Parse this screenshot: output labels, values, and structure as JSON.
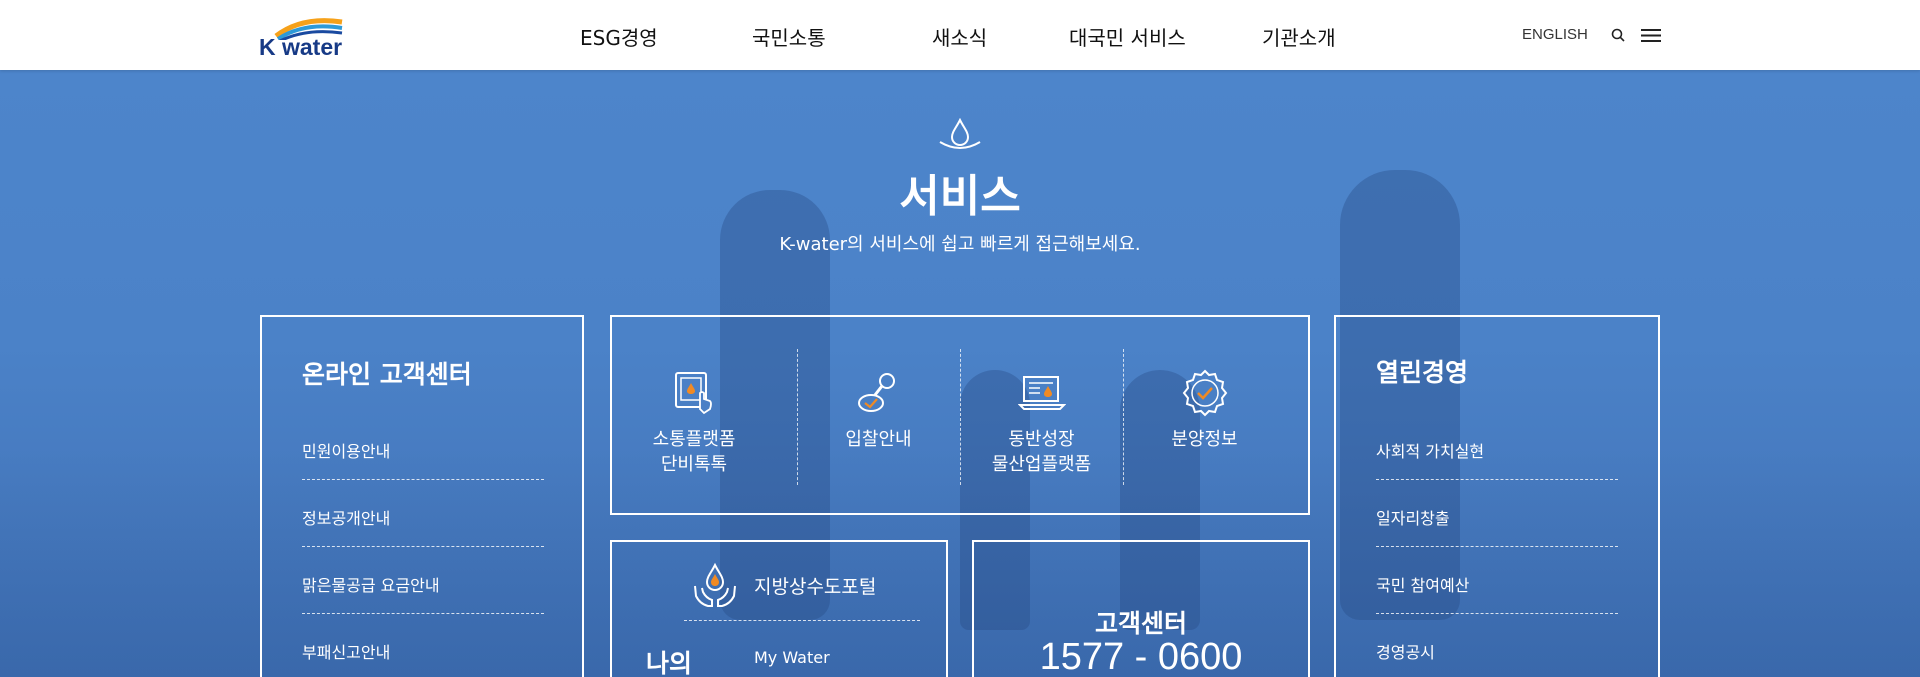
{
  "header": {
    "logo_text": "K water",
    "nav": [
      {
        "label": "ESG경영"
      },
      {
        "label": "국민소통"
      },
      {
        "label": "새소식"
      },
      {
        "label": "대국민 서비스"
      },
      {
        "label": "기관소개"
      }
    ],
    "english_label": "ENGLISH",
    "icons": [
      "search-icon",
      "hamburger-menu-icon"
    ]
  },
  "colors": {
    "brand_navy": "#173a86",
    "hero_blue": "#4a80c6",
    "white": "#ffffff",
    "accent_orange": "#f08a24"
  },
  "services_section": {
    "icon": "water-drop-icon",
    "title": "서비스",
    "subtitle": "K-water의 서비스에 쉽고 빠르게 접근해보세요."
  },
  "online_center": {
    "title": "온라인 고객센터",
    "items": [
      {
        "label": "민원이용안내"
      },
      {
        "label": "정보공개안내"
      },
      {
        "label": "맑은물공급 요금안내"
      },
      {
        "label": "부패신고안내"
      }
    ]
  },
  "services": [
    {
      "line1": "소통플랫폼",
      "line2": "단비톡톡",
      "icon": "tablet-touch-icon"
    },
    {
      "line1": "입찰안내",
      "line2": "",
      "icon": "stamp-icon"
    },
    {
      "line1": "동반성장",
      "line2": "물산업플랫폼",
      "icon": "laptop-drop-icon"
    },
    {
      "line1": "분양정보",
      "line2": "",
      "icon": "badge-check-icon"
    }
  ],
  "local_portal": {
    "portal_label": "지방상수도포털",
    "my_label": "나의",
    "mywater_label": "My Water"
  },
  "customer_center": {
    "title": "고객센터",
    "phone": "1577 - 0600"
  },
  "open_management": {
    "title": "열린경영",
    "items": [
      {
        "label": "사회적 가치실현"
      },
      {
        "label": "일자리창출"
      },
      {
        "label": "국민 참여예산"
      },
      {
        "label": "경영공시"
      }
    ]
  }
}
